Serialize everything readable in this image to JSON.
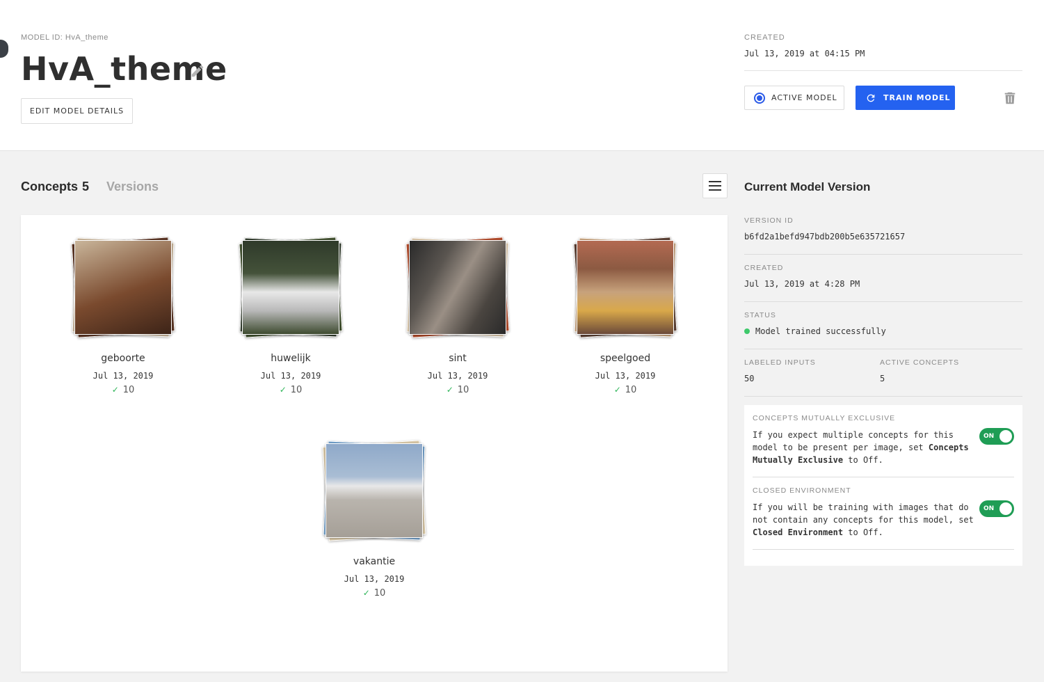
{
  "header": {
    "model_id_label": "MODEL ID: HvA_theme",
    "title": "HvA_theme",
    "edit_button": "EDIT MODEL DETAILS",
    "created_label": "CREATED",
    "created_value": "Jul 13, 2019 at 04:15 PM",
    "active_button": "ACTIVE MODEL",
    "train_button": "TRAIN MODEL"
  },
  "tabs": {
    "concepts_label": "Concepts",
    "concepts_count": "5",
    "versions_label": "Versions"
  },
  "concepts": [
    {
      "name": "geboorte",
      "date": "Jul 13, 2019",
      "count": "10",
      "colors": [
        "#7a4a2e",
        "#c9b59a",
        "#5b3524"
      ]
    },
    {
      "name": "huwelijk",
      "date": "Jul 13, 2019",
      "count": "10",
      "colors": [
        "#2f3a2a",
        "#e8e8e8",
        "#41502f"
      ]
    },
    {
      "name": "sint",
      "date": "Jul 13, 2019",
      "count": "10",
      "colors": [
        "#3a3a3a",
        "#9a8f85",
        "#b04a2a"
      ]
    },
    {
      "name": "speelgoed",
      "date": "Jul 13, 2019",
      "count": "10",
      "colors": [
        "#8c5a42",
        "#c7a27c",
        "#5b4033"
      ]
    },
    {
      "name": "vakantie",
      "date": "Jul 13, 2019",
      "count": "10",
      "colors": [
        "#8fa9c9",
        "#b9b4ad",
        "#d8c7a6"
      ]
    }
  ],
  "current_version": {
    "title": "Current Model Version",
    "version_id_label": "VERSION ID",
    "version_id": "b6fd2a1befd947bdb200b5e635721657",
    "created_label": "CREATED",
    "created_value": "Jul 13, 2019 at 4:28 PM",
    "status_label": "STATUS",
    "status_value": "Model trained successfully",
    "labeled_inputs_label": "LABELED INPUTS",
    "labeled_inputs": "50",
    "active_concepts_label": "ACTIVE CONCEPTS",
    "active_concepts": "5"
  },
  "settings": {
    "mutually_exclusive": {
      "label": "CONCEPTS MUTUALLY EXCLUSIVE",
      "text_1": "If you expect multiple concepts for this model to be present per image, set ",
      "bold": "Concepts Mutually Exclusive",
      "text_2": " to Off.",
      "toggle": "ON"
    },
    "closed_environment": {
      "label": "CLOSED ENVIRONMENT",
      "text_1": "If you will be training with images that do not contain any concepts for this model, set ",
      "bold": "Closed Environment",
      "text_2": " to Off.",
      "toggle": "ON"
    }
  },
  "colors": {
    "accent_blue": "#2462f0",
    "status_green": "#3ec96b",
    "toggle_green": "#1f9d55"
  }
}
